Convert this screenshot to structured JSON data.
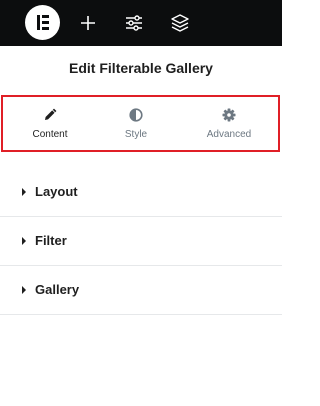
{
  "toolbar": {
    "logo_icon": "elementor-logo-icon",
    "add_icon": "plus-icon",
    "settings_icon": "sliders-icon",
    "structure_icon": "layers-icon"
  },
  "panel": {
    "title": "Edit Filterable Gallery"
  },
  "tabs": [
    {
      "label": "Content",
      "icon": "pencil-icon",
      "active": true
    },
    {
      "label": "Style",
      "icon": "half-circle-icon",
      "active": false
    },
    {
      "label": "Advanced",
      "icon": "gear-icon",
      "active": false
    }
  ],
  "sections": [
    {
      "label": "Layout"
    },
    {
      "label": "Filter"
    },
    {
      "label": "Gallery"
    }
  ],
  "colors": {
    "topbar": "#0c0d0e",
    "highlight_border": "#e01f26",
    "muted_text": "#6d7882"
  }
}
